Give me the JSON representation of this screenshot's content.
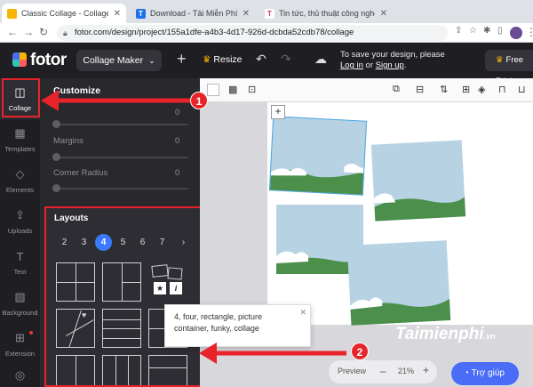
{
  "browser": {
    "tabs": [
      {
        "label": "Classic Collage - Collage | Fot",
        "favicon_color": "#f7b500"
      },
      {
        "label": "Download - Tải Miễn Phí VN",
        "favicon_color": "#1a73e8"
      },
      {
        "label": "Tin tức, thủ thuật công nghệ",
        "favicon_color": "#e8234b"
      }
    ],
    "url": "fotor.com/design/project/155a1dfe-a4b3-4d17-926d-dcbda52cdb78/collage"
  },
  "header": {
    "logo": "fotor",
    "mode_label": "Collage Maker",
    "resize_label": "Resize",
    "save_line1": "To save your design, please",
    "login_label": "Log in",
    "or_label": "or",
    "signup_label": "Sign up",
    "freetrial_label": "Free Trial"
  },
  "sidebar": {
    "items": [
      {
        "label": "Collage",
        "icon": "collage-icon"
      },
      {
        "label": "Templates",
        "icon": "templates-icon"
      },
      {
        "label": "Elements",
        "icon": "elements-icon"
      },
      {
        "label": "Uploads",
        "icon": "uploads-icon"
      },
      {
        "label": "Text",
        "icon": "text-icon"
      },
      {
        "label": "Background",
        "icon": "background-icon"
      },
      {
        "label": "Extension",
        "icon": "extension-icon"
      }
    ]
  },
  "panel": {
    "title": "Customize",
    "spacing_value": "0",
    "margins_label": "Margins",
    "margins_value": "0",
    "radius_label": "Corner Radius",
    "radius_value": "0"
  },
  "layouts": {
    "title": "Layouts",
    "counts": [
      "2",
      "3",
      "4",
      "5",
      "6",
      "7"
    ],
    "selected": "4"
  },
  "tooltip": {
    "line1": "4, four, rectangle, picture",
    "line2": "container, funky, collage"
  },
  "canvas": {
    "preview_label": "Preview",
    "zoom": "21%",
    "help_label": "Trợ giúp"
  },
  "annotations": {
    "step1": "1",
    "step2": "2",
    "watermark_main": "Taimienphi",
    "watermark_suffix": ".vn"
  },
  "colors": {
    "accent_red": "#e8232a",
    "primary_blue": "#3a7afe",
    "dark_bg": "#1f1f23"
  }
}
